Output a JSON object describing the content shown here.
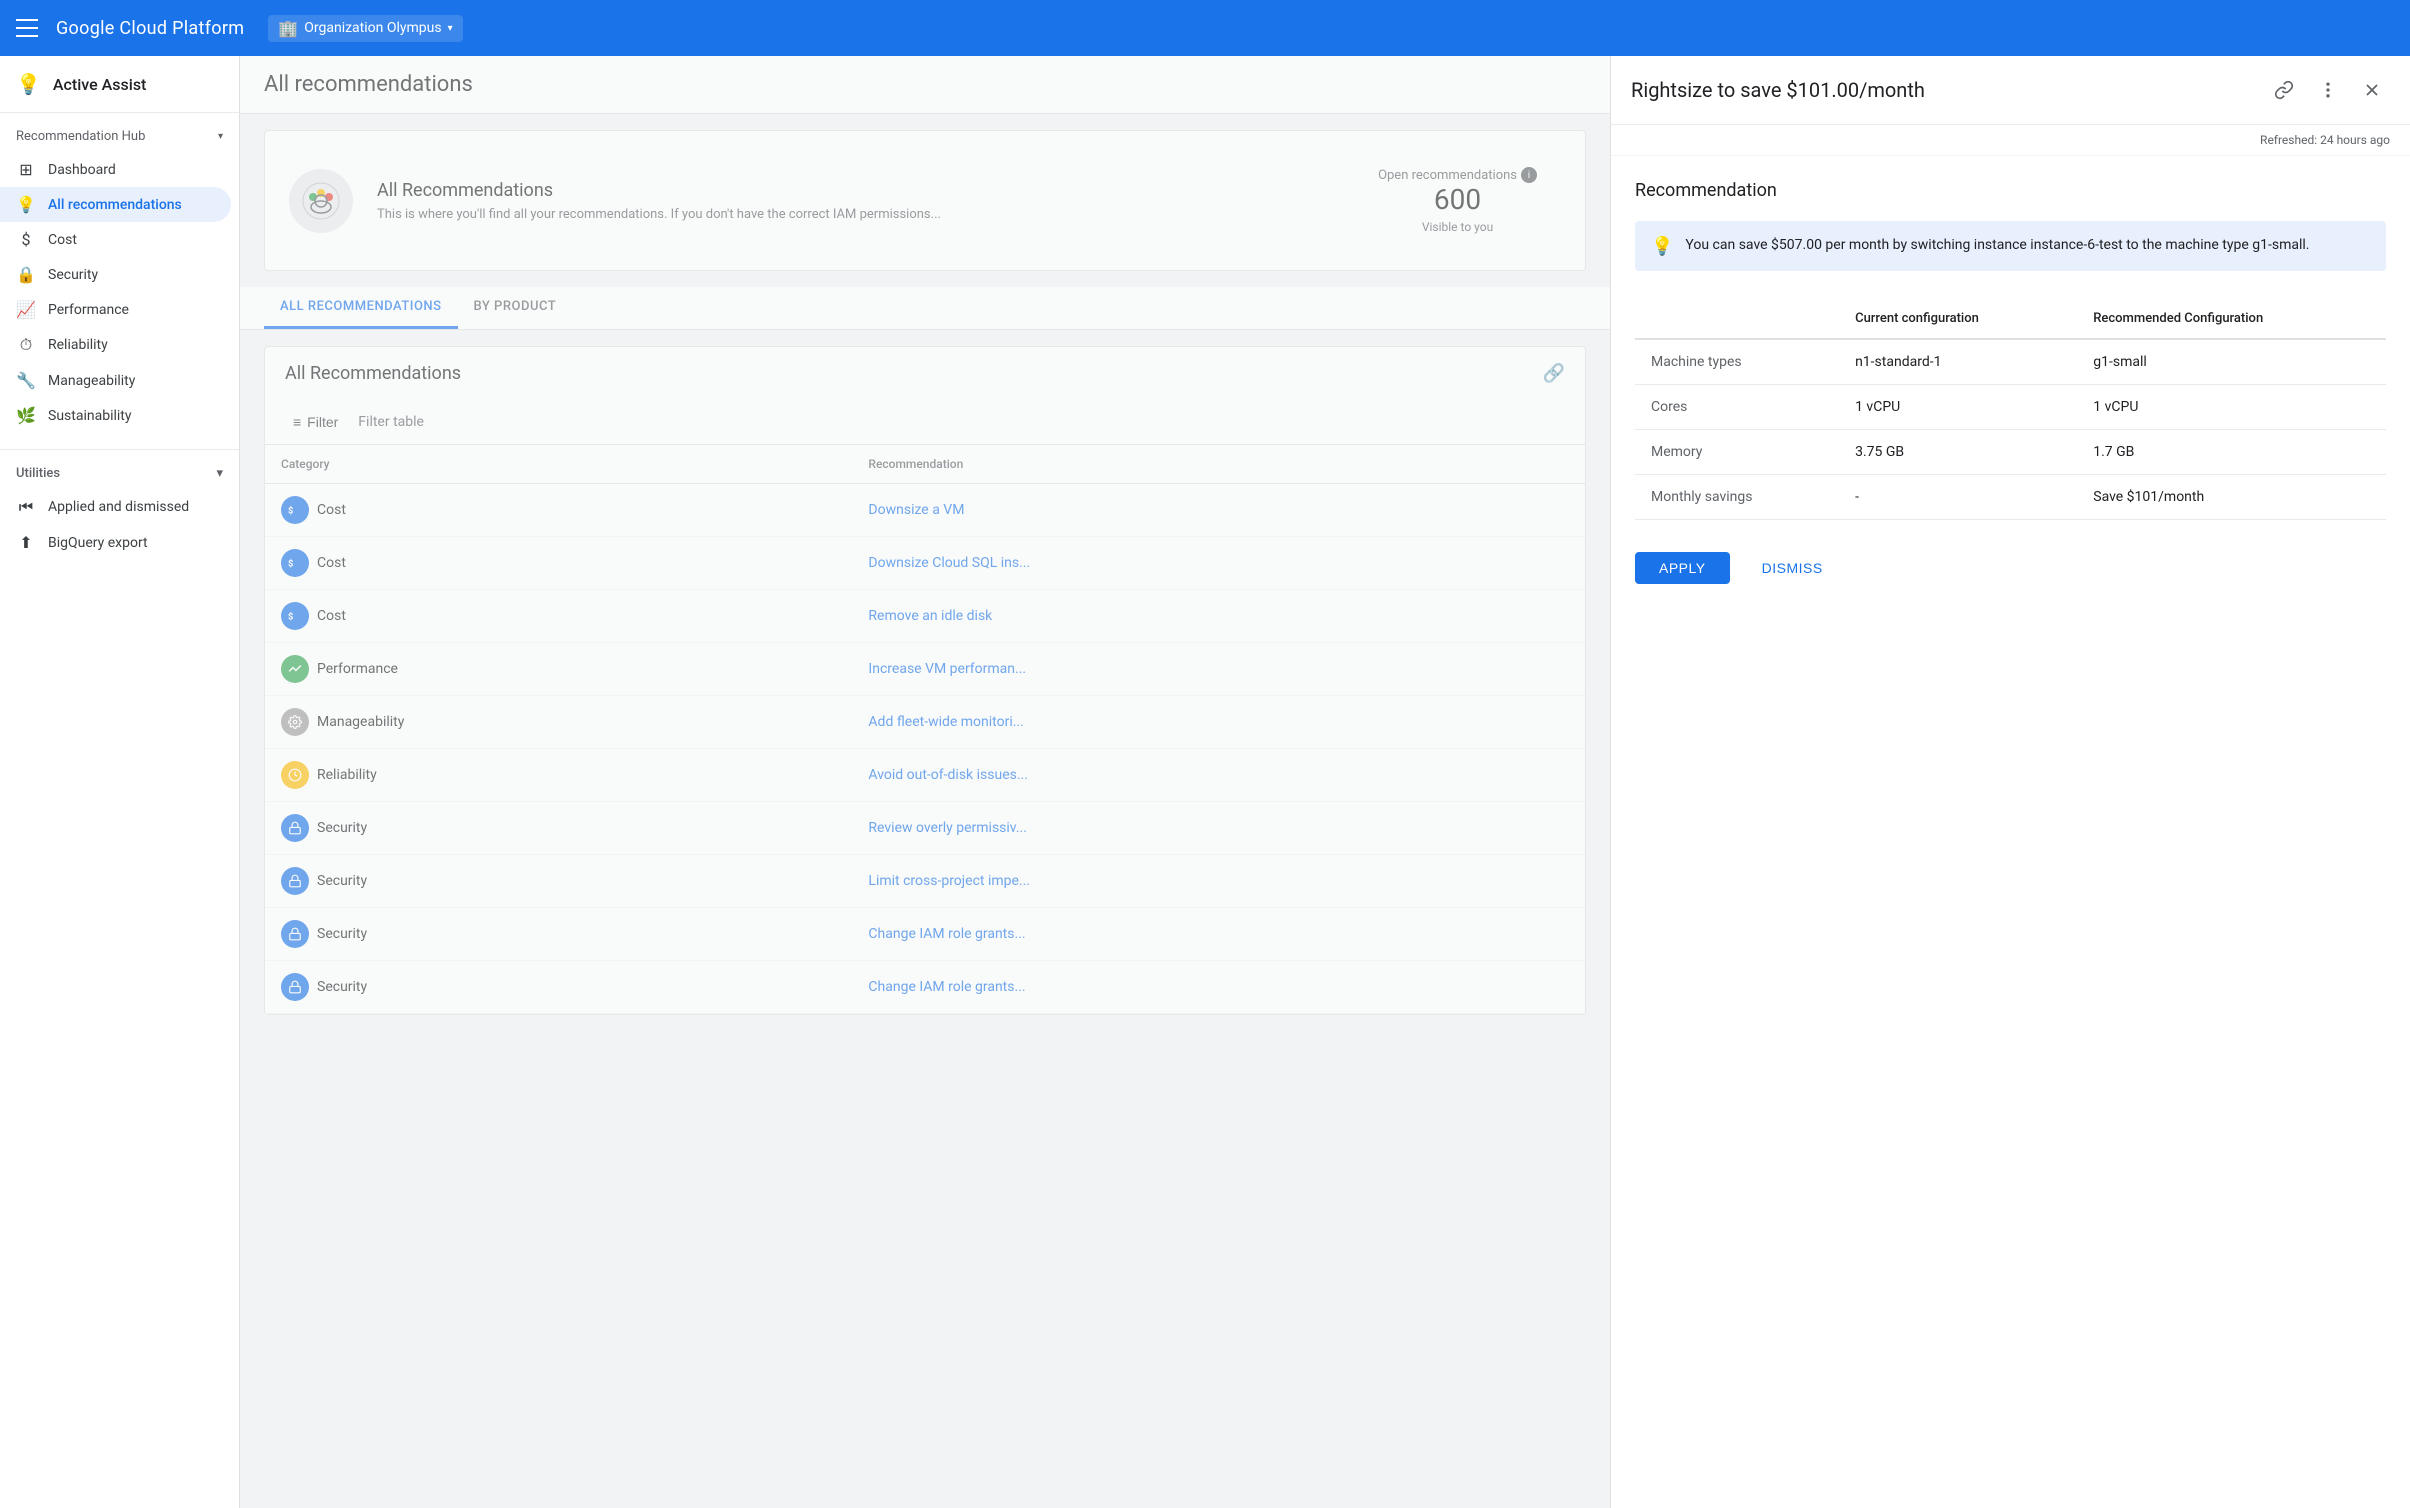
{
  "topNav": {
    "menuIcon": "☰",
    "brand": "Google Cloud Platform",
    "org": {
      "icon": "🏢",
      "name": "Organization Olympus",
      "chevron": "▾"
    }
  },
  "sidebar": {
    "header": {
      "icon": "💡",
      "title": "Active Assist"
    },
    "recommendationHub": {
      "label": "Recommendation Hub",
      "chevron": "▾"
    },
    "items": [
      {
        "id": "dashboard",
        "icon": "⊞",
        "label": "Dashboard",
        "active": false
      },
      {
        "id": "all-recommendations",
        "icon": "💡",
        "label": "All recommendations",
        "active": true
      },
      {
        "id": "cost",
        "icon": "$",
        "label": "Cost",
        "active": false
      },
      {
        "id": "security",
        "icon": "🔒",
        "label": "Security",
        "active": false
      },
      {
        "id": "performance",
        "icon": "📈",
        "label": "Performance",
        "active": false
      },
      {
        "id": "reliability",
        "icon": "⏱",
        "label": "Reliability",
        "active": false
      },
      {
        "id": "manageability",
        "icon": "🔧",
        "label": "Manageability",
        "active": false
      },
      {
        "id": "sustainability",
        "icon": "🌿",
        "label": "Sustainability",
        "active": false
      }
    ],
    "utilities": {
      "label": "Utilities",
      "chevron": "▾",
      "items": [
        {
          "id": "applied-dismissed",
          "icon": "⏮",
          "label": "Applied and dismissed"
        },
        {
          "id": "bigquery-export",
          "icon": "⬆",
          "label": "BigQuery export"
        }
      ]
    }
  },
  "pageHeader": {
    "title": "All recommendations"
  },
  "banner": {
    "title": "All Recommendations",
    "description": "This is where you'll find all your recommendations. If you don't have the correct IAM permissions...",
    "openRecs": {
      "label": "Open recommendations",
      "count": "600",
      "visible": "Visible to you"
    }
  },
  "tabs": [
    {
      "id": "all",
      "label": "ALL RECOMMENDATIONS",
      "active": true
    },
    {
      "id": "by-product",
      "label": "BY PRODUCT",
      "active": false
    }
  ],
  "allRecommendations": {
    "title": "All Recommendations",
    "filter": {
      "icon": "≡",
      "label": "Filter",
      "placeholder": "Filter table"
    },
    "columns": [
      "Category",
      "Recommendation"
    ],
    "rows": [
      {
        "category": "Cost",
        "categoryType": "cost",
        "recommendation": "Downsize a VM"
      },
      {
        "category": "Cost",
        "categoryType": "cost",
        "recommendation": "Downsize Cloud SQL ins..."
      },
      {
        "category": "Cost",
        "categoryType": "cost",
        "recommendation": "Remove an idle disk"
      },
      {
        "category": "Performance",
        "categoryType": "performance",
        "recommendation": "Increase VM performan..."
      },
      {
        "category": "Manageability",
        "categoryType": "manageability",
        "recommendation": "Add fleet-wide monitori..."
      },
      {
        "category": "Reliability",
        "categoryType": "reliability",
        "recommendation": "Avoid out-of-disk issues..."
      },
      {
        "category": "Security",
        "categoryType": "security",
        "recommendation": "Review overly permissiv..."
      },
      {
        "category": "Security",
        "categoryType": "security",
        "recommendation": "Limit cross-project impe..."
      },
      {
        "category": "Security",
        "categoryType": "security",
        "recommendation": "Change IAM role grants..."
      },
      {
        "category": "Security",
        "categoryType": "security",
        "recommendation": "Change IAM role grants..."
      }
    ]
  },
  "sidePanel": {
    "title": "Rightsize to save $101.00/month",
    "refreshText": "Refreshed: 24 hours ago",
    "sectionTitle": "Recommendation",
    "infoBanner": {
      "text": "You can save $507.00 per month by switching instance instance-6-test to the machine type g1-small."
    },
    "table": {
      "headers": [
        "",
        "Current configuration",
        "Recommended Configuration"
      ],
      "rows": [
        {
          "label": "Machine types",
          "current": "n1-standard-1",
          "recommended": "g1-small"
        },
        {
          "label": "Cores",
          "current": "1 vCPU",
          "recommended": "1 vCPU"
        },
        {
          "label": "Memory",
          "current": "3.75 GB",
          "recommended": "1.7 GB"
        },
        {
          "label": "Monthly savings",
          "current": "-",
          "recommended": "Save $101/month"
        }
      ]
    },
    "actions": {
      "apply": "APPLY",
      "dismiss": "DISMISS"
    }
  }
}
